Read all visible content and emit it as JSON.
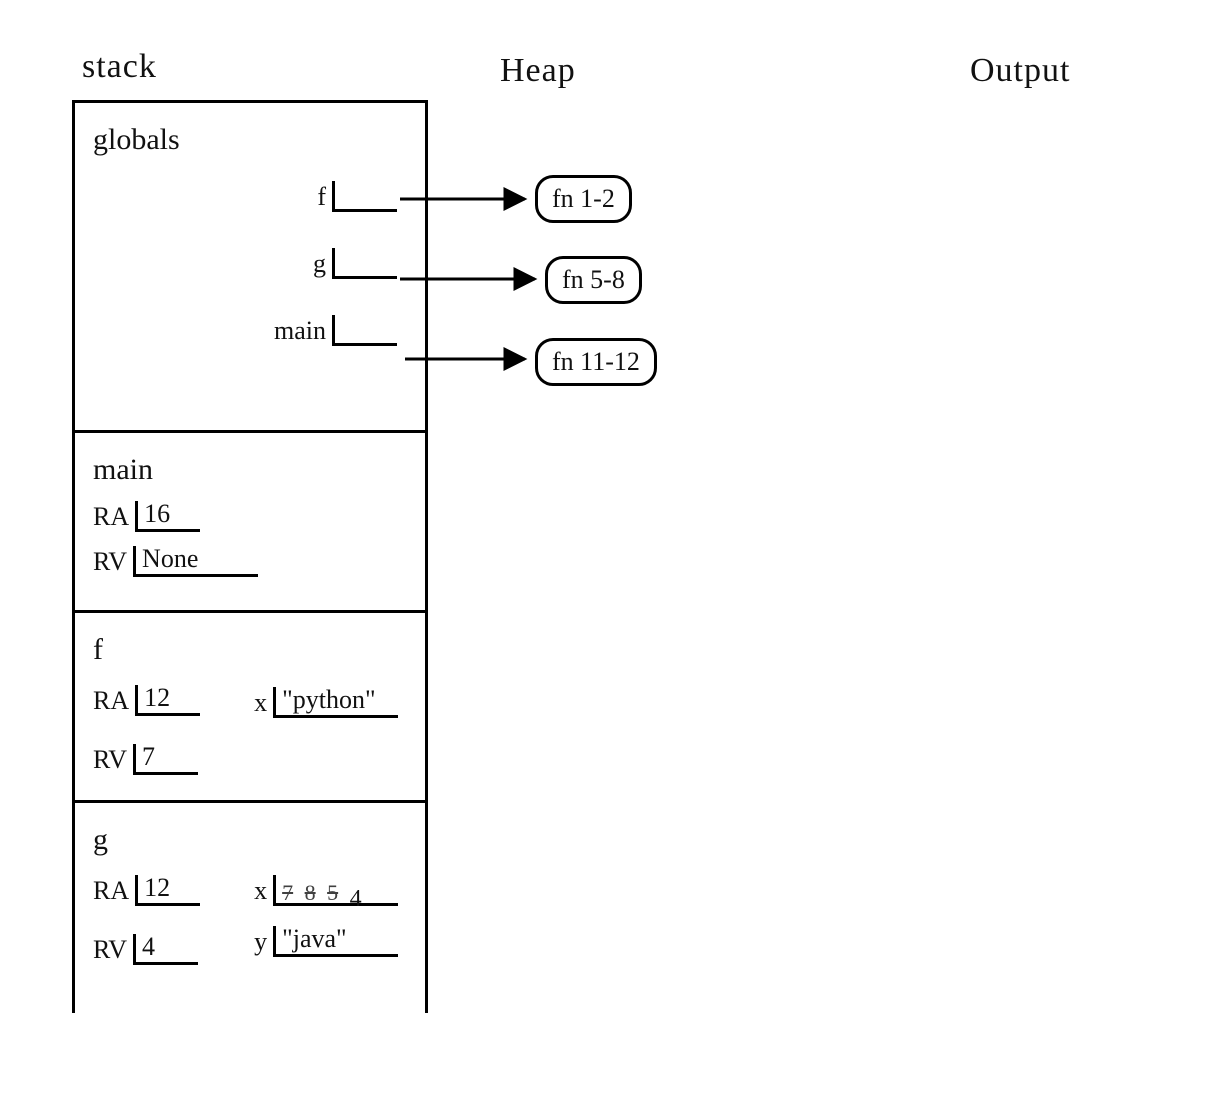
{
  "headers": {
    "stack": "stack",
    "heap": "Heap",
    "output": "Output"
  },
  "stack": {
    "globals": {
      "title": "globals",
      "vars": {
        "f": "f",
        "g": "g",
        "main": "main"
      }
    },
    "frames": [
      {
        "name": "main",
        "ra_label": "RA",
        "ra": "16",
        "rv_label": "RV",
        "rv": "None",
        "locals": []
      },
      {
        "name": "f",
        "ra_label": "RA",
        "ra": "12",
        "rv_label": "RV",
        "rv": "7",
        "locals": [
          {
            "name": "x",
            "value": "\"python\""
          }
        ]
      },
      {
        "name": "g",
        "ra_label": "RA",
        "ra": "12",
        "rv_label": "RV",
        "rv": "4",
        "locals": [
          {
            "name": "x",
            "history": [
              "7",
              "8",
              "5"
            ],
            "value": "4"
          },
          {
            "name": "y",
            "value": "\"java\""
          }
        ]
      }
    ]
  },
  "heap": [
    {
      "id": "fn_f",
      "label": "fn 1-2"
    },
    {
      "id": "fn_g",
      "label": "fn 5-8"
    },
    {
      "id": "fn_main",
      "label": "fn 11-12"
    }
  ],
  "output": []
}
